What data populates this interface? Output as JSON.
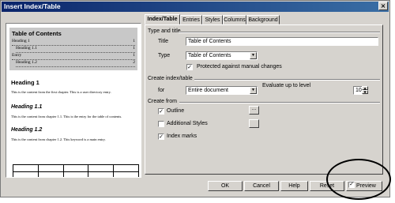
{
  "window": {
    "title": "Insert Index/Table",
    "close": "×"
  },
  "preview": {
    "toc_title": "Table of Contents",
    "toc_lines": [
      {
        "text": "Heading 1",
        "page": "1"
      },
      {
        "text": "Heading 1.1",
        "page": "1"
      },
      {
        "text": "Entry",
        "page": "1"
      },
      {
        "text": "Heading 1.2",
        "page": "2"
      }
    ],
    "heading1": "Heading 1",
    "text1": "This is the content from the first chapter. This is a user directory entry.",
    "heading11": "Heading 1.1",
    "text11": "This is the content from chapter 1.1. This is the entry for the table of contents.",
    "heading12": "Heading 1.2",
    "text12": "This is the content from chapter 1.2. This keyword is a main entry."
  },
  "tabs": [
    "Index/Table",
    "Entries",
    "Styles",
    "Columns",
    "Background"
  ],
  "type_title": {
    "section": "Type and title",
    "title_label": "Title",
    "title_value": "Table of Contents",
    "type_label": "Type",
    "type_value": "Table of Contents",
    "protected_label": "Protected against manual changes",
    "protected_checked": true
  },
  "create_index": {
    "section": "Create index/table",
    "for_label": "for",
    "for_value": "Entire document",
    "evaluate_label": "Evaluate up to level",
    "level_value": "10"
  },
  "create_from": {
    "section": "Create from",
    "outline_label": "Outline",
    "outline_checked": true,
    "outline_btn": "...",
    "additional_label": "Additional Styles",
    "additional_checked": false,
    "index_marks_label": "Index marks",
    "index_marks_checked": true
  },
  "buttons": {
    "ok": "OK",
    "cancel": "Cancel",
    "help": "Help",
    "reset": "Reset",
    "preview_label": "Preview",
    "preview_checked": true
  },
  "check_mark": "✓",
  "arrow_down": "▼",
  "arrow_up": "▲"
}
